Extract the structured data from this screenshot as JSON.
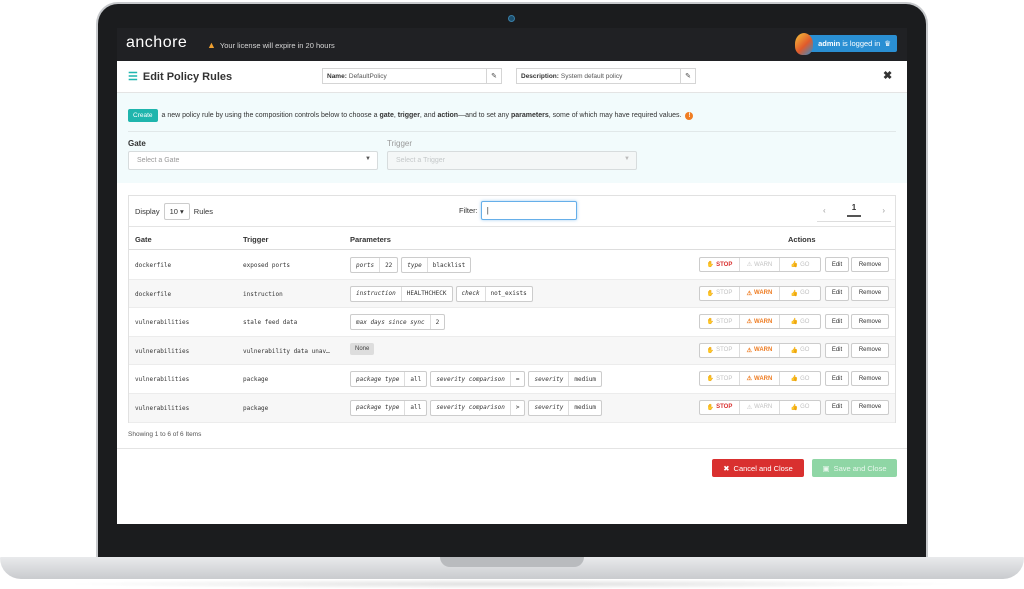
{
  "app": {
    "logo": "anchore",
    "license_notice": "Your license will expire in 20 hours",
    "admin_user": "admin",
    "admin_suffix": "is logged in"
  },
  "modal": {
    "title": "Edit Policy Rules",
    "name_label": "Name:",
    "name_value": "DefaultPolicy",
    "description_label": "Description:",
    "description_value": "System default policy",
    "close": "✖"
  },
  "compose": {
    "create_button": "Create",
    "text_1": "a new policy rule by using the composition controls below to choose a",
    "gate_word": "gate",
    "comma_1": ",",
    "trigger_word": "trigger",
    "and_word": ", and",
    "action_word": "action",
    "text_2": "—and to set any",
    "parameters_word": "parameters",
    "text_3": ", some of which may have required values.",
    "gate_label": "Gate",
    "gate_placeholder": "Select a Gate",
    "trigger_label": "Trigger",
    "trigger_placeholder": "Select a Trigger"
  },
  "table": {
    "display_label": "Display",
    "display_value": "10",
    "rules_label": "Rules",
    "filter_label": "Filter:",
    "filter_value": "",
    "pager_prev": "‹",
    "pager_page": "1",
    "pager_next": "›",
    "columns": {
      "gate": "Gate",
      "trigger": "Trigger",
      "parameters": "Parameters",
      "actions": "Actions"
    },
    "action_labels": {
      "stop": "STOP",
      "warn": "WARN",
      "go": "GO",
      "edit": "Edit",
      "remove": "Remove"
    },
    "rows": [
      {
        "gate": "dockerfile",
        "trigger": "exposed ports",
        "action": "stop",
        "params": [
          {
            "k": "ports",
            "v": "22"
          },
          {
            "k": "type",
            "v": "blacklist"
          }
        ]
      },
      {
        "gate": "dockerfile",
        "trigger": "instruction",
        "action": "warn",
        "params": [
          {
            "k": "instruction",
            "v": "HEALTHCHECK"
          },
          {
            "k": "check",
            "v": "not_exists"
          }
        ]
      },
      {
        "gate": "vulnerabilities",
        "trigger": "stale feed data",
        "action": "warn",
        "params": [
          {
            "k": "max days since sync",
            "v": "2"
          }
        ]
      },
      {
        "gate": "vulnerabilities",
        "trigger": "vulnerability data unav…",
        "action": "warn",
        "params": [],
        "none_label": "None"
      },
      {
        "gate": "vulnerabilities",
        "trigger": "package",
        "action": "warn",
        "params": [
          {
            "k": "package type",
            "v": "all"
          },
          {
            "k": "severity comparison",
            "v": "="
          },
          {
            "k": "severity",
            "v": "medium"
          }
        ]
      },
      {
        "gate": "vulnerabilities",
        "trigger": "package",
        "action": "stop",
        "params": [
          {
            "k": "package type",
            "v": "all"
          },
          {
            "k": "severity comparison",
            "v": ">"
          },
          {
            "k": "severity",
            "v": "medium"
          }
        ]
      }
    ],
    "showing": "Showing 1 to 6 of 6 Items"
  },
  "footer": {
    "cancel_label": "Cancel and Close",
    "save_label": "Save and Close"
  },
  "colors": {
    "accent": "#1fb5ad",
    "stop": "#d9302f",
    "warn": "#ee7d24",
    "go": "#2e9d49",
    "save_disabled": "#8fd6a5",
    "admin": "#2a8fd3"
  },
  "icons": {
    "logo": "anchore-wordmark",
    "license": "warning-icon",
    "admin": "user-icon",
    "title": "list-icon",
    "edit": "edit-icon",
    "close": "close-icon",
    "info": "info-icon",
    "stop": "hand-stop-icon",
    "warn": "warning-icon",
    "go": "thumbs-up-icon",
    "cancel": "close-icon",
    "save": "floppy-disk-icon"
  }
}
